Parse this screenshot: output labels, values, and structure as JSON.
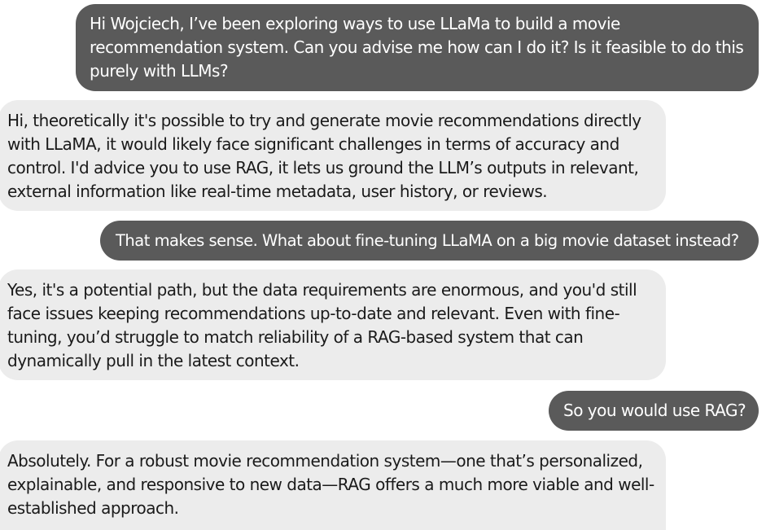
{
  "messages": [
    {
      "role": "user",
      "lines": [
        "Hi Wojciech, I’ve been exploring ways to use LLaMa to build a movie",
        "recommendation system. Can you advise me how can I do it? Is it feasible to do this",
        "purely with LLMs?"
      ]
    },
    {
      "role": "assistant",
      "lines": [
        "Hi, theoretically it's possible to try and generate movie recommendations directly",
        "with LLaMA, it would likely face significant challenges in terms of accuracy and",
        "control. I'd advice you to use RAG, it lets us ground the LLM’s outputs in relevant,",
        "external information like real-time metadata, user history, or reviews."
      ]
    },
    {
      "role": "user",
      "lines": [
        "That makes sense. What about fine-tuning LLaMA on a big movie dataset instead?"
      ]
    },
    {
      "role": "assistant",
      "lines": [
        "Yes, it's a potential path, but the data requirements are enormous, and you'd still",
        "face issues keeping recommendations up-to-date and relevant. Even with fine-",
        "tuning, you’d struggle to match reliability of a RAG-based system that can",
        "dynamically pull in the latest context."
      ]
    },
    {
      "role": "user",
      "lines": [
        "So you would use RAG?"
      ]
    },
    {
      "role": "assistant",
      "lines": [
        "Absolutely. For a robust movie recommendation system—one that’s personalized,",
        "explainable, and responsive to new data—RAG offers a much more viable and well-",
        "established approach."
      ]
    }
  ],
  "colors": {
    "sent_bubble": "#5a5a5a",
    "sent_text": "#ffffff",
    "received_bubble": "#ececec",
    "received_text": "#1a1a1a",
    "background": "#ffffff"
  }
}
